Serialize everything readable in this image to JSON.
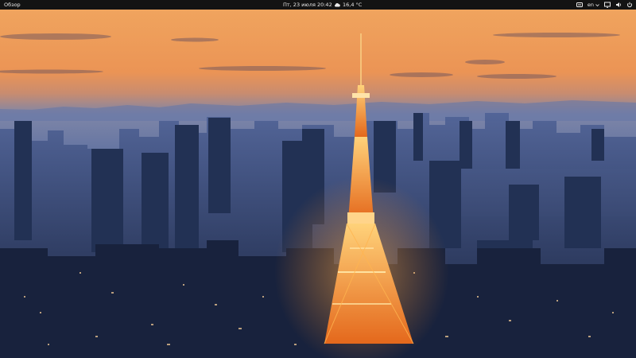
{
  "topbar": {
    "activities_label": "Обзор",
    "clock": "Пт, 23 июля  20:42",
    "weather": "16,4 °C",
    "keyboard_layout": "en"
  },
  "desktop": {
    "wallpaper": "tokyo-tower-night-skyline",
    "colors": {
      "sky_top": "#f2a15a",
      "sky_horizon": "#e58a4d",
      "haze": "#5f74a6",
      "city": "#1c2948",
      "tower_glow": "#ff9a2e"
    }
  }
}
